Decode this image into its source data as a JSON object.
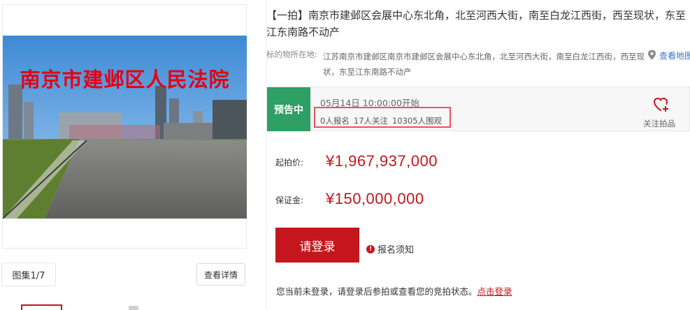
{
  "gallery": {
    "photo_caption": "南京市建邺区人民法院",
    "album_label": "图集1/7",
    "detail_button": "查看详情"
  },
  "lot": {
    "title": "【一拍】南京市建邺区会展中心东北角，北至河西大街，南至白龙江西街，西至现状，东至江东南路不动产",
    "location_label": "标的物所在地:",
    "location_text": "江苏南京市建邺区南京市建邺区会展中心东北角，北至河西大街，南至白龙江西街，西至现状，东至江东南路不动产",
    "map_link": "查看地图"
  },
  "status": {
    "badge": "预告中",
    "start_time": "05月14日 10:00:00开始",
    "signups": "0人报名",
    "followers": "17人关注",
    "views": "10305人围观",
    "follow_label": "关注拍品"
  },
  "prices": {
    "start_label": "起拍价:",
    "start_value": "¥1,967,937,000",
    "deposit_label": "保证金:",
    "deposit_value": "¥150,000,000"
  },
  "actions": {
    "login_button": "请登录",
    "notice_label": "报名须知",
    "hint_prefix": "您当前未登录，请登录后参拍或查看您的竞拍状态。",
    "hint_link": "点击登录"
  },
  "colors": {
    "accent_red": "#c5161d",
    "status_green": "#2e9f65",
    "link_blue": "#3a76c4"
  },
  "icons": [
    "map-pin-icon",
    "heart-plus-icon",
    "alert-icon"
  ]
}
